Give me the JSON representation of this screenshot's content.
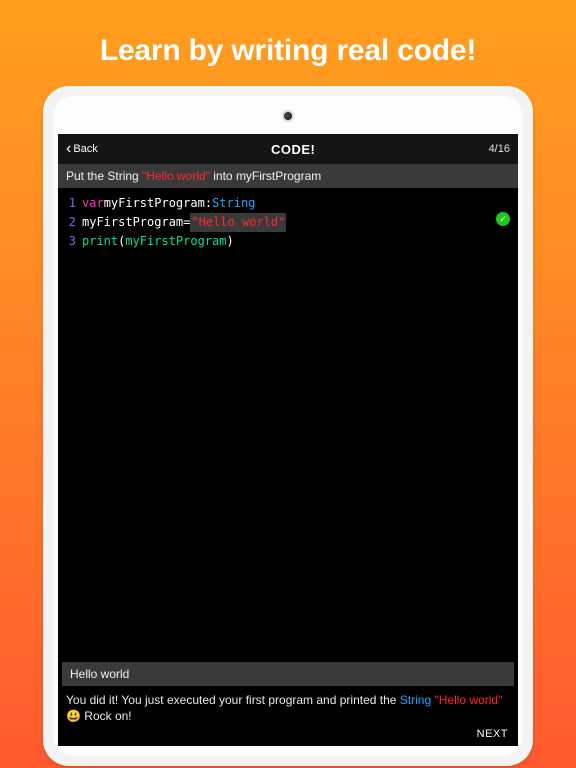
{
  "page": {
    "headline": "Learn by writing real code!"
  },
  "nav": {
    "back": "Back",
    "title": "CODE!",
    "progress": "4/16"
  },
  "instruction": {
    "prefix": "Put the String ",
    "string": "\"Hello world\"",
    "suffix": " into myFirstProgram"
  },
  "code": {
    "ln1": "1",
    "ln2": "2",
    "ln3": "3",
    "l1_kw": "var",
    "l1_id": " myFirstProgram:",
    "l1_type": " String",
    "l2_id": "myFirstProgram ",
    "l2_eq": "= ",
    "l2_str": "\"Hello world\"",
    "l3_fn": "print",
    "l3_open": "(",
    "l3_arg": "myFirstProgram",
    "l3_close": ")",
    "check": "✓"
  },
  "output": "Hello world",
  "feedback": {
    "t1": "You did it!  You just executed your first program and printed the ",
    "t2": "String",
    "t3": " \"Hello world\"",
    "t4": " 😃 Rock on!"
  },
  "next": "NEXT"
}
